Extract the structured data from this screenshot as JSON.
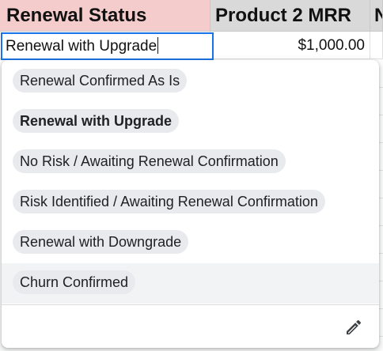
{
  "sheet": {
    "headers": {
      "col_a": "Renewal Status",
      "col_b": "Product 2 MRR",
      "col_c": "N"
    },
    "row": {
      "col_b_value": "$1,000.00"
    },
    "editor_value": "Renewal with Upgrade"
  },
  "dropdown": {
    "options": [
      {
        "label": "Renewal Confirmed As Is"
      },
      {
        "label": "Renewal with Upgrade",
        "selected": true
      },
      {
        "label": "No Risk / Awaiting Renewal Confirmation"
      },
      {
        "label": "Risk Identified / Awaiting Renewal Confirmation"
      },
      {
        "label": "Renewal with Downgrade"
      },
      {
        "label": "Churn Confirmed",
        "hovered": true
      }
    ],
    "edit_icon": "pencil-icon"
  },
  "colors": {
    "header_a_bg": "#f4cccc",
    "header_bg": "#d9d9d9",
    "editor_border": "#1a73e8",
    "chip_bg": "#e8eaed",
    "hover_bg": "#f1f3f4"
  }
}
